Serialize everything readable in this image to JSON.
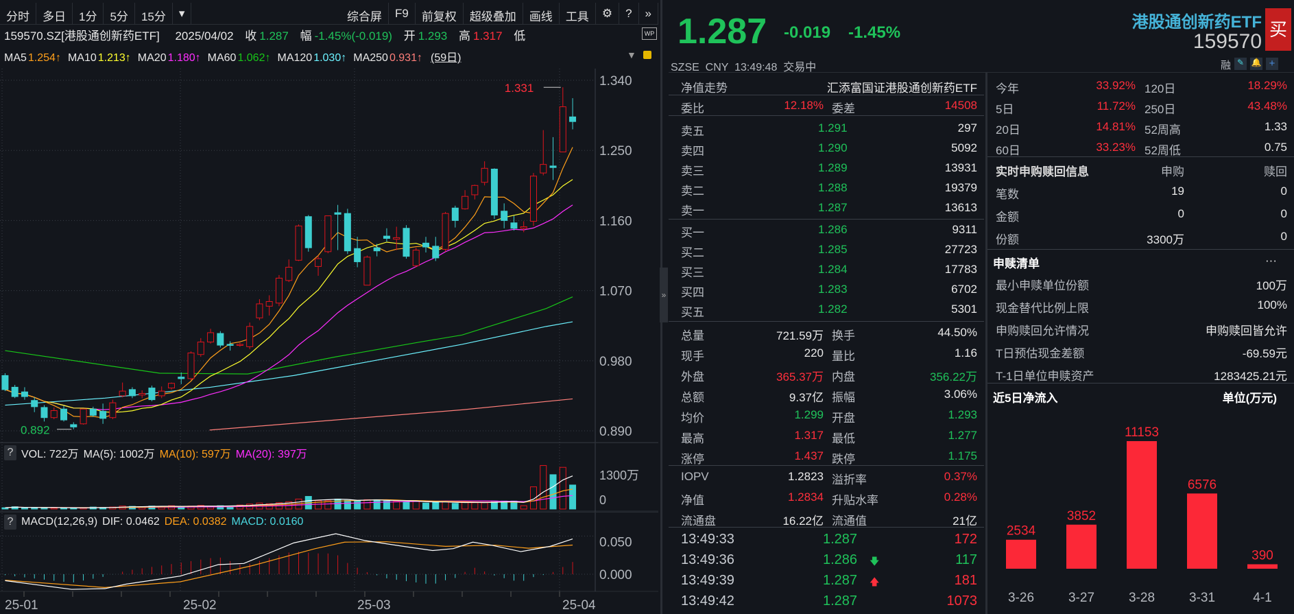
{
  "toolbar": {
    "left": [
      "分时",
      "多日",
      "1分",
      "5分",
      "15分",
      "▾"
    ],
    "right": [
      "综合屏",
      "F9",
      "前复权",
      "超级叠加",
      "画线",
      "工具",
      "⚙",
      "?",
      "»"
    ]
  },
  "info": {
    "code_name": "159570.SZ[港股通创新药ETF]",
    "date": "2025/04/02",
    "close_label": "收",
    "close": "1.287",
    "range_label": "幅",
    "range": "-1.45%(-0.019)",
    "open_label": "开",
    "open": "1.293",
    "high_label": "高",
    "high": "1.317",
    "low_label": "低",
    "wp": "WP"
  },
  "ma_legend": [
    {
      "label": "MA5",
      "value": "1.254↑",
      "color": "#ff9f1a"
    },
    {
      "label": "MA10",
      "value": "1.213↑",
      "color": "#ffff2e"
    },
    {
      "label": "MA20",
      "value": "1.180↑",
      "color": "#ff2eff"
    },
    {
      "label": "MA60",
      "value": "1.062↑",
      "color": "#18c618"
    },
    {
      "label": "MA120",
      "value": "1.030↑",
      "color": "#6cf2ff"
    },
    {
      "label": "MA250",
      "value": "0.931↑",
      "color": "#ff7f7a"
    }
  ],
  "period": "(59日)",
  "vol_legend": {
    "help": "?",
    "vol": "VOL: 722万",
    "ma5": "MA(5): 1002万",
    "ma10": "MA(10): 597万",
    "ma20": "MA(20): 397万"
  },
  "macd_legend": {
    "help": "?",
    "name": "MACD(12,26,9)",
    "dif": "DIF: 0.0462",
    "dea": "DEA: 0.0382",
    "macd": "MACD: 0.0160"
  },
  "quote": {
    "price": "1.287",
    "change": "-0.019",
    "pct": "-1.45%",
    "name": "港股通创新药ETF",
    "code": "159570",
    "buy": "买",
    "meta": "SZSE  CNY  13:49:48  交易中",
    "rong": "融"
  },
  "nav": {
    "label": "净值走势",
    "fund": "汇添富国证港股通创新药ETF"
  },
  "weibi": {
    "l1": "委比",
    "v1": "12.18%",
    "l2": "委差",
    "v2": "14508"
  },
  "asks": [
    {
      "label": "卖五",
      "price": "1.291",
      "vol": "297"
    },
    {
      "label": "卖四",
      "price": "1.290",
      "vol": "5092"
    },
    {
      "label": "卖三",
      "price": "1.289",
      "vol": "13931"
    },
    {
      "label": "卖二",
      "price": "1.288",
      "vol": "19379"
    },
    {
      "label": "卖一",
      "price": "1.287",
      "vol": "13613"
    }
  ],
  "bids": [
    {
      "label": "买一",
      "price": "1.286",
      "vol": "9311"
    },
    {
      "label": "买二",
      "price": "1.285",
      "vol": "27723"
    },
    {
      "label": "买三",
      "price": "1.284",
      "vol": "17783"
    },
    {
      "label": "买四",
      "price": "1.283",
      "vol": "6702"
    },
    {
      "label": "买五",
      "price": "1.282",
      "vol": "5301"
    }
  ],
  "stats": [
    {
      "l1": "总量",
      "v1": "721.59万",
      "c1": "white",
      "l2": "换手",
      "v2": "44.50%",
      "c2": "white"
    },
    {
      "l1": "现手",
      "v1": "220",
      "c1": "white",
      "l2": "量比",
      "v2": "1.16",
      "c2": "white"
    },
    {
      "l1": "外盘",
      "v1": "365.37万",
      "c1": "red",
      "l2": "内盘",
      "v2": "356.22万",
      "c2": "green"
    },
    {
      "l1": "总额",
      "v1": "9.37亿",
      "c1": "white",
      "l2": "振幅",
      "v2": "3.06%",
      "c2": "white"
    },
    {
      "l1": "均价",
      "v1": "1.299",
      "c1": "green",
      "l2": "开盘",
      "v2": "1.293",
      "c2": "green"
    },
    {
      "l1": "最高",
      "v1": "1.317",
      "c1": "red",
      "l2": "最低",
      "v2": "1.277",
      "c2": "green"
    },
    {
      "l1": "涨停",
      "v1": "1.437",
      "c1": "red",
      "l2": "跌停",
      "v2": "1.175",
      "c2": "green"
    }
  ],
  "etf": [
    {
      "l1": "IOPV",
      "v1": "1.2823",
      "c1": "white",
      "l2": "溢折率",
      "v2": "0.37%",
      "c2": "red"
    },
    {
      "l1": "净值",
      "v1": "1.2834",
      "c1": "red",
      "l2": "升贴水率",
      "v2": "0.28%",
      "c2": "red"
    },
    {
      "l1": "流通盘",
      "v1": "16.22亿",
      "c1": "white",
      "l2": "流通值",
      "v2": "21亿",
      "c2": "white"
    }
  ],
  "ticks": [
    {
      "time": "13:49:33",
      "price": "1.287",
      "arrow": "",
      "vol": "172",
      "vc": "red"
    },
    {
      "time": "13:49:36",
      "price": "1.286",
      "arrow": "🡇",
      "vol": "117",
      "vc": "green"
    },
    {
      "time": "13:49:39",
      "price": "1.287",
      "arrow": "🡅",
      "vol": "181",
      "vc": "red"
    },
    {
      "time": "13:49:42",
      "price": "1.287",
      "arrow": "",
      "vol": "1073",
      "vc": "red"
    }
  ],
  "returns": [
    {
      "l1": "今年",
      "v1": "33.92%",
      "l2": "120日",
      "v2": "18.29%",
      "c2": "red"
    },
    {
      "l1": "5日",
      "v1": "11.72%",
      "l2": "250日",
      "v2": "43.48%",
      "c2": "red"
    },
    {
      "l1": "20日",
      "v1": "14.81%",
      "l2": "52周高",
      "v2": "1.33",
      "c2": "white"
    },
    {
      "l1": "60日",
      "v1": "33.23%",
      "l2": "52周低",
      "v2": "0.75",
      "c2": "white"
    }
  ],
  "realtime": {
    "title": "实时申购赎回信息",
    "col1": "申购",
    "col2": "赎回",
    "rows": [
      {
        "label": "笔数",
        "v1": "19",
        "v2": "0"
      },
      {
        "label": "金额",
        "v1": "0",
        "v2": "0"
      },
      {
        "label": "份额",
        "v1": "3300万",
        "v2": "0"
      }
    ]
  },
  "list": {
    "title": "申赎清单",
    "more": "···",
    "rows": [
      {
        "label": "最小申赎单位份额",
        "value": "100万"
      },
      {
        "label": "现金替代比例上限",
        "value": "100%"
      },
      {
        "label": "申购赎回允许情况",
        "value": "申购赎回皆允许"
      },
      {
        "label": "T日预估现金差额",
        "value": "-69.59元"
      },
      {
        "label": "T-1日单位申赎资产",
        "value": "1283425.21元"
      }
    ]
  },
  "chart_data": [
    {
      "type": "candlestick",
      "title": "159570.SZ 日K",
      "y_ticks": [
        "1.340",
        "1.250",
        "1.160",
        "1.070",
        "0.980",
        "0.890"
      ],
      "y_tick_values": [
        1.34,
        1.25,
        1.16,
        1.07,
        0.98,
        0.89
      ],
      "x_ticks": [
        "25-01",
        "25-02",
        "25-03",
        "25-04"
      ],
      "x_tick_index": [
        0,
        18,
        36,
        57
      ],
      "high_marker": {
        "label": "1.331",
        "index": 57
      },
      "low_marker": {
        "label": "0.892",
        "index": 7
      },
      "ohlc": [
        [
          0.961,
          0.964,
          0.941,
          0.943
        ],
        [
          0.946,
          0.949,
          0.932,
          0.934
        ],
        [
          0.94,
          0.946,
          0.93,
          0.934
        ],
        [
          0.929,
          0.933,
          0.914,
          0.921
        ],
        [
          0.92,
          0.923,
          0.902,
          0.907
        ],
        [
          0.907,
          0.92,
          0.905,
          0.916
        ],
        [
          0.918,
          0.922,
          0.902,
          0.904
        ],
        [
          0.898,
          0.901,
          0.892,
          0.895
        ],
        [
          0.899,
          0.918,
          0.898,
          0.918
        ],
        [
          0.918,
          0.921,
          0.908,
          0.91
        ],
        [
          0.915,
          0.925,
          0.899,
          0.906
        ],
        [
          0.907,
          0.93,
          0.905,
          0.926
        ],
        [
          0.935,
          0.952,
          0.933,
          0.941
        ],
        [
          0.943,
          0.946,
          0.932,
          0.935
        ],
        [
          0.936,
          0.942,
          0.932,
          0.938
        ],
        [
          0.945,
          0.948,
          0.928,
          0.93
        ],
        [
          0.935,
          0.947,
          0.932,
          0.941
        ],
        [
          0.945,
          0.952,
          0.943,
          0.951
        ],
        [
          0.959,
          0.965,
          0.95,
          0.957
        ],
        [
          0.957,
          0.992,
          0.955,
          0.99
        ],
        [
          0.988,
          1.009,
          0.985,
          1.004
        ],
        [
          1.004,
          1.021,
          1.002,
          1.016
        ],
        [
          1.015,
          1.018,
          0.997,
          1.0
        ],
        [
          1.001,
          1.005,
          0.993,
          1.0
        ],
        [
          1.0,
          1.003,
          0.998,
          1.001
        ],
        [
          0.998,
          1.029,
          0.995,
          1.024
        ],
        [
          1.035,
          1.059,
          1.032,
          1.053
        ],
        [
          1.05,
          1.064,
          1.038,
          1.056
        ],
        [
          1.054,
          1.09,
          1.05,
          1.086
        ],
        [
          1.083,
          1.11,
          1.081,
          1.1
        ],
        [
          1.109,
          1.155,
          1.108,
          1.153
        ],
        [
          1.165,
          1.167,
          1.12,
          1.125
        ],
        [
          1.101,
          1.115,
          1.089,
          1.111
        ],
        [
          1.12,
          1.166,
          1.118,
          1.166
        ],
        [
          1.17,
          1.18,
          1.122,
          1.168
        ],
        [
          1.169,
          1.175,
          1.117,
          1.121
        ],
        [
          1.124,
          1.139,
          1.1,
          1.107
        ],
        [
          1.077,
          1.115,
          1.077,
          1.113
        ],
        [
          1.125,
          1.13,
          1.114,
          1.121
        ],
        [
          1.14,
          1.15,
          1.133,
          1.137
        ],
        [
          1.136,
          1.152,
          1.122,
          1.138
        ],
        [
          1.15,
          1.154,
          1.111,
          1.114
        ],
        [
          1.102,
          1.125,
          1.1,
          1.122
        ],
        [
          1.131,
          1.139,
          1.119,
          1.126
        ],
        [
          1.127,
          1.139,
          1.108,
          1.112
        ],
        [
          1.123,
          1.171,
          1.12,
          1.169
        ],
        [
          1.176,
          1.179,
          1.151,
          1.16
        ],
        [
          1.175,
          1.199,
          1.174,
          1.191
        ],
        [
          1.193,
          1.206,
          1.187,
          1.205
        ],
        [
          1.209,
          1.236,
          1.205,
          1.227
        ],
        [
          1.226,
          1.227,
          1.162,
          1.167
        ],
        [
          1.172,
          1.182,
          1.15,
          1.16
        ],
        [
          1.157,
          1.166,
          1.147,
          1.15
        ],
        [
          1.15,
          1.159,
          1.145,
          1.152
        ],
        [
          1.159,
          1.221,
          1.153,
          1.217
        ],
        [
          1.221,
          1.276,
          1.218,
          1.232
        ],
        [
          1.23,
          1.267,
          1.212,
          1.228
        ],
        [
          1.248,
          1.331,
          1.248,
          1.306
        ],
        [
          1.293,
          1.317,
          1.277,
          1.287
        ]
      ],
      "ma60": [
        [
          0,
          0.993
        ],
        [
          15.8,
          0.964
        ],
        [
          24.8,
          0.963
        ],
        [
          33.8,
          0.985
        ],
        [
          42.4,
          1.004
        ],
        [
          46.7,
          1.013
        ],
        [
          51,
          1.03
        ],
        [
          55.3,
          1.047
        ],
        [
          58,
          1.062
        ]
      ],
      "ma120": [
        [
          0,
          0.923
        ],
        [
          10.2,
          0.932
        ],
        [
          21,
          0.946
        ],
        [
          29.5,
          0.961
        ],
        [
          38.1,
          0.981
        ],
        [
          46.7,
          1.001
        ],
        [
          55.3,
          1.024
        ],
        [
          58,
          1.03
        ]
      ],
      "ma250": [
        [
          20.9,
          0.891
        ],
        [
          33.8,
          0.904
        ],
        [
          46.7,
          0.917
        ],
        [
          58,
          0.931
        ]
      ],
      "volume_unit": "万",
      "volume": [
        40,
        70,
        40,
        50,
        40,
        30,
        40,
        30,
        30,
        60,
        50,
        60,
        90,
        80,
        70,
        90,
        80,
        100,
        60,
        90,
        110,
        80,
        100,
        90,
        120,
        150,
        180,
        160,
        190,
        220,
        300,
        380,
        250,
        250,
        300,
        260,
        250,
        280,
        280,
        240,
        230,
        220,
        240,
        180,
        200,
        220,
        170,
        210,
        190,
        190,
        240,
        240,
        240,
        100,
        667,
        1307,
        1032,
        1252,
        722
      ],
      "vol_ticks": [
        "1300万",
        "0"
      ],
      "macd": {
        "dif": [
          [
            0,
            -0.0084
          ],
          [
            6.8,
            -0.0198
          ],
          [
            10.2,
            -0.0189
          ],
          [
            12.4,
            -0.0129
          ],
          [
            17.9,
            -0.0024
          ],
          [
            21.8,
            0.0126
          ],
          [
            24.4,
            0.0141
          ],
          [
            29.5,
            0.041
          ],
          [
            33.8,
            0.053
          ],
          [
            36.8,
            0.044
          ],
          [
            40.7,
            0.0365
          ],
          [
            43.7,
            0.031
          ],
          [
            45.8,
            0.0335
          ],
          [
            47.8,
            0.042
          ],
          [
            49.7,
            0.038
          ],
          [
            52.7,
            0.0296
          ],
          [
            55.7,
            0.0365
          ],
          [
            58,
            0.0462
          ]
        ],
        "dea": [
          [
            0,
            -0.0078
          ],
          [
            10.2,
            -0.0174
          ],
          [
            17.9,
            -0.0099
          ],
          [
            25.2,
            0.011
          ],
          [
            31.7,
            0.0335
          ],
          [
            34.7,
            0.042
          ],
          [
            39,
            0.0425
          ],
          [
            45,
            0.0365
          ],
          [
            50.1,
            0.038
          ],
          [
            53.5,
            0.034
          ],
          [
            58,
            0.0382
          ]
        ],
        "ticks": [
          "0.050",
          "0.000"
        ]
      }
    },
    {
      "type": "bar",
      "title": "近5日净流入",
      "unit": "单位(万元)",
      "categories": [
        "3-26",
        "3-27",
        "3-28",
        "3-31",
        "4-1"
      ],
      "values": [
        2534,
        3852,
        11153,
        6576,
        390
      ],
      "labels": [
        "2534",
        "3852",
        "11153",
        "6576",
        "390"
      ],
      "color": "#fc2837"
    }
  ]
}
